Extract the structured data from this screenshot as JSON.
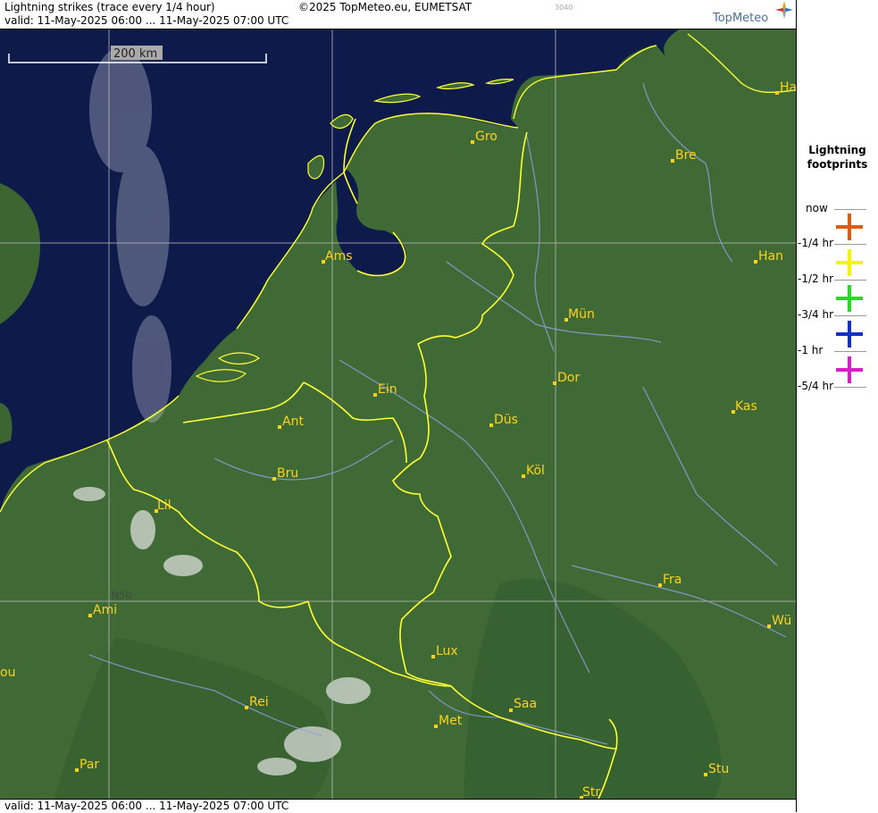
{
  "header": {
    "title": "Lightning strikes (trace every 1/4 hour)",
    "copyright": "©2025 TopMeteo.eu, EUMETSAT",
    "code": "3040",
    "valid": "valid:  11-May-2025 06:00 ... 11-May-2025 07:00 UTC",
    "brand": "TopMeteo"
  },
  "footer": {
    "valid": "valid:  11-May-2025 06:00 ... 11-May-2025 07:00 UTC"
  },
  "map": {
    "scale_label": "200 km",
    "lat_label": "N50",
    "colors": {
      "sea": "#0d1a4a",
      "land": "#3f6a35",
      "border": "#ffff33",
      "river": "#8f9fe0",
      "grid": "#b8b8b8",
      "city": "#ffd21a"
    },
    "cities": [
      "Gro",
      "Bre",
      "Ha",
      "Ams",
      "Han",
      "Mün",
      "Dor",
      "Ein",
      "Ant",
      "Düs",
      "Kas",
      "Bru",
      "Köl",
      "Lil",
      "Fra",
      "Ami",
      "Wü",
      "Lux",
      "ou",
      "Rei",
      "Saa",
      "Met",
      "Par",
      "Stu",
      "Str"
    ]
  },
  "legend": {
    "title_line1": "Lightning",
    "title_line2": "footprints",
    "steps": [
      {
        "label": "now",
        "color": "#e05a10"
      },
      {
        "label": "-1/4 hr",
        "color": "#f5f500"
      },
      {
        "label": "-1/2 hr",
        "color": "#22dd22"
      },
      {
        "label": "-3/4 hr",
        "color": "#1030c8"
      },
      {
        "label": "-1 hr",
        "color": "#d81ec8"
      },
      {
        "label": "-5/4 hr",
        "color": ""
      }
    ]
  }
}
